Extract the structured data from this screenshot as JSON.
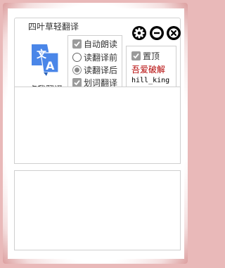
{
  "app": {
    "title": "四叶草轻翻译"
  },
  "controls": {
    "settings": "gear-icon",
    "minimize": "minus-circle-icon",
    "close": "x-circle-icon"
  },
  "translate": {
    "icon": "google-translate-icon",
    "label": "点我翻译",
    "icon_color": "#4a86e8"
  },
  "options": [
    {
      "type": "checkbox",
      "checked": true,
      "label": "自动朗读"
    },
    {
      "type": "radio",
      "checked": false,
      "label": "读翻译前"
    },
    {
      "type": "radio",
      "checked": true,
      "label": "读翻译后"
    },
    {
      "type": "checkbox",
      "checked": true,
      "label": "划词翻译"
    }
  ],
  "side": {
    "topmost": {
      "checked": true,
      "label": "置顶"
    },
    "crack_label": "吾爱破解",
    "crack_color": "#b30000",
    "author": "hill_king"
  },
  "panes": {
    "source_text": "",
    "result_text": ""
  }
}
